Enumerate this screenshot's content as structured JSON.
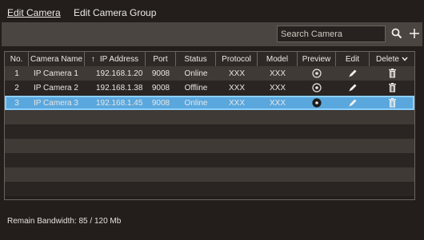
{
  "tabs": [
    {
      "label": "Edit Camera",
      "active": true
    },
    {
      "label": "Edit Camera Group",
      "active": false
    }
  ],
  "search": {
    "placeholder": "Search Camera"
  },
  "toolbar": {
    "search_icon": "search-icon",
    "add_icon": "plus-icon"
  },
  "table": {
    "headers": {
      "no": "No.",
      "camera_name": "Camera Name",
      "ip_address": "IP Address",
      "ip_sort_glyph": "↑",
      "port": "Port",
      "status": "Status",
      "protocol": "Protocol",
      "model": "Model",
      "preview": "Preview",
      "edit": "Edit",
      "delete": "Delete"
    },
    "rows": [
      {
        "no": "1",
        "name": "IP Camera 1",
        "ip": "192.168.1.20",
        "port": "9008",
        "status": "Online",
        "protocol": "XXX",
        "model": "XXX"
      },
      {
        "no": "2",
        "name": "IP Camera 2",
        "ip": "192.168.1.38",
        "port": "9008",
        "status": "Offline",
        "protocol": "XXX",
        "model": "XXX"
      },
      {
        "no": "3",
        "name": "IP Camera 3",
        "ip": "192.168.1.45",
        "port": "9008",
        "status": "Online",
        "protocol": "XXX",
        "model": "XXX"
      }
    ],
    "selected_row": 3
  },
  "footer": {
    "bandwidth": "Remain Bandwidth: 85 / 120 Mb"
  },
  "colors": {
    "selected_row": "#5aa7dd",
    "selected_outline": "#8ed0ff",
    "background": "#231e1c"
  }
}
